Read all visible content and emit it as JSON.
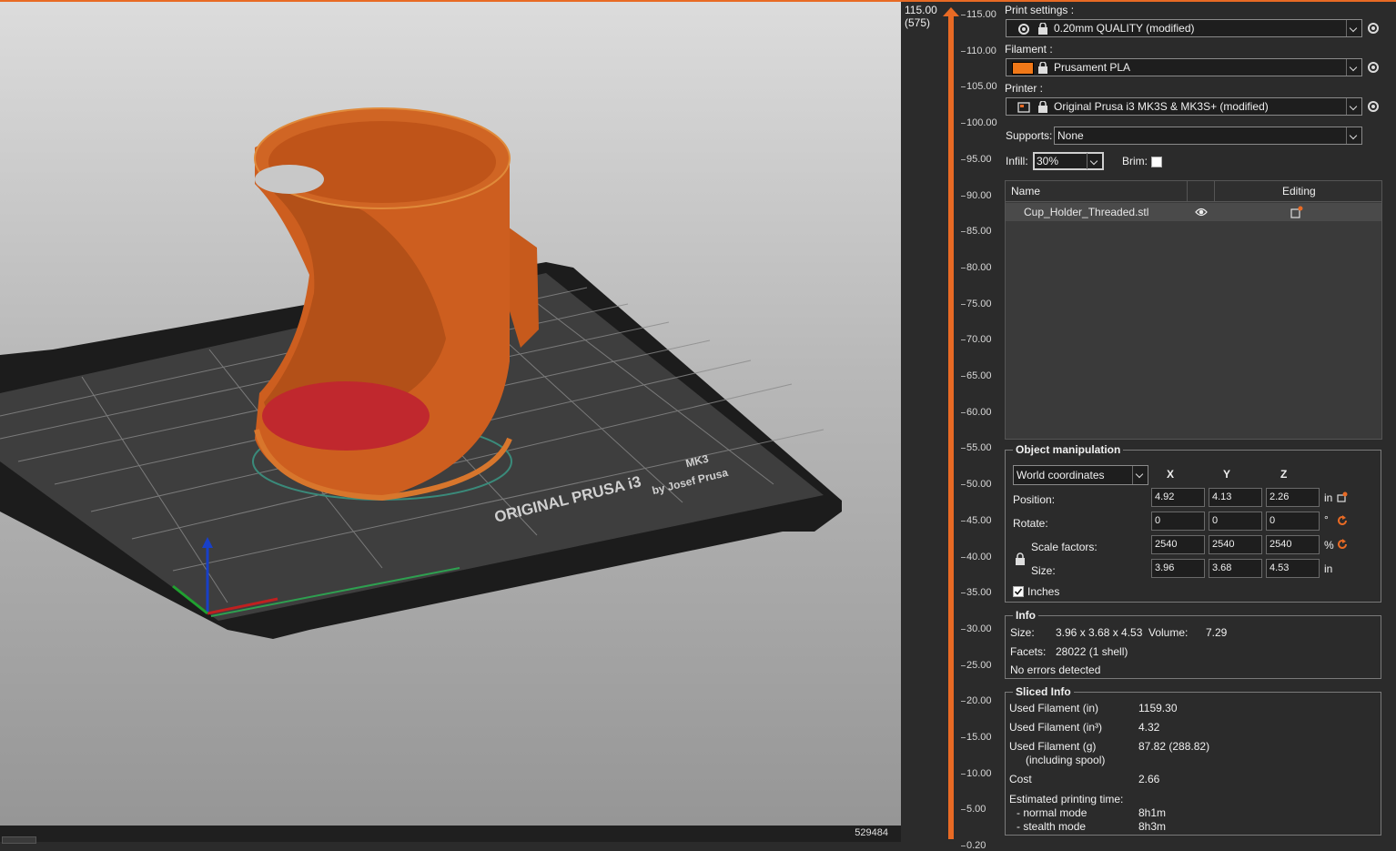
{
  "viewport": {
    "bed_text_line1": "ORIGINAL PRUSA i3",
    "bed_text_mk3": "MK3",
    "bed_text_line2": "by Josef Prusa",
    "counter": "529484"
  },
  "layer_slider": {
    "top_value": "115.00",
    "top_layer": "(575)",
    "ticks": [
      "115.00",
      "110.00",
      "105.00",
      "100.00",
      "95.00",
      "90.00",
      "85.00",
      "80.00",
      "75.00",
      "70.00",
      "65.00",
      "60.00",
      "55.00",
      "50.00",
      "45.00",
      "40.00",
      "35.00",
      "30.00",
      "25.00",
      "20.00",
      "15.00",
      "10.00",
      "5.00",
      "0.20"
    ]
  },
  "settings": {
    "print_label": "Print settings :",
    "print_value": "0.20mm QUALITY (modified)",
    "filament_label": "Filament :",
    "filament_value": "Prusament PLA",
    "filament_color": "#f07818",
    "printer_label": "Printer :",
    "printer_value": "Original Prusa i3 MK3S & MK3S+ (modified)",
    "supports_label": "Supports:",
    "supports_value": "None",
    "infill_label": "Infill:",
    "infill_value": "30%",
    "brim_label": "Brim:"
  },
  "object_list": {
    "col_name": "Name",
    "col_editing": "Editing",
    "items": [
      {
        "name": "Cup_Holder_Threaded.stl"
      }
    ]
  },
  "manipulation": {
    "title": "Object manipulation",
    "coord_mode": "World coordinates",
    "axes": [
      "X",
      "Y",
      "Z"
    ],
    "position_label": "Position:",
    "position": [
      "4.92",
      "4.13",
      "2.26"
    ],
    "position_unit": "in",
    "rotate_label": "Rotate:",
    "rotate": [
      "0",
      "0",
      "0"
    ],
    "rotate_unit": "°",
    "scale_label": "Scale factors:",
    "scale": [
      "2540",
      "2540",
      "2540"
    ],
    "scale_unit": "%",
    "size_label": "Size:",
    "size": [
      "3.96",
      "3.68",
      "4.53"
    ],
    "size_unit": "in",
    "inches_label": "Inches"
  },
  "info": {
    "title": "Info",
    "size_label": "Size:",
    "size_value": "3.96 x 3.68 x 4.53",
    "volume_label": "Volume:",
    "volume_value": "7.29",
    "facets_label": "Facets:",
    "facets_value": "28022 (1 shell)",
    "errors": "No errors detected"
  },
  "sliced_info": {
    "title": "Sliced Info",
    "used_in_label": "Used Filament (in)",
    "used_in_value": "1159.30",
    "used_in3_label": "Used Filament (in³)",
    "used_in3_value": "4.32",
    "used_g_label": "Used Filament (g)",
    "used_g_sub": "(including spool)",
    "used_g_value": "87.82 (288.82)",
    "cost_label": "Cost",
    "cost_value": "2.66",
    "time_label": "Estimated printing time:",
    "normal_label": "- normal mode",
    "normal_value": "8h1m",
    "stealth_label": "- stealth mode",
    "stealth_value": "8h3m"
  }
}
